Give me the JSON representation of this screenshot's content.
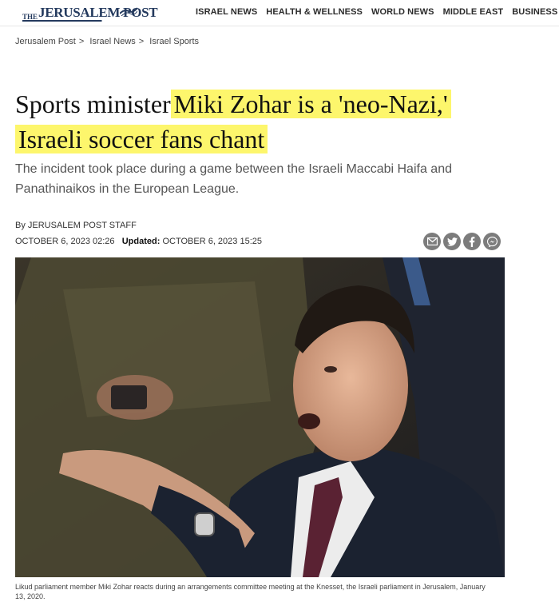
{
  "header": {
    "logo_the": "THE",
    "logo_name": "JERUSALEM POST",
    "nav": [
      {
        "label": "ISRAEL NEWS"
      },
      {
        "label": "HEALTH & WELLNESS"
      },
      {
        "label": "WORLD NEWS"
      },
      {
        "label": "MIDDLE EAST"
      },
      {
        "label": "BUSINESS & INNOVATION"
      }
    ]
  },
  "breadcrumb": [
    {
      "label": "Jerusalem Post"
    },
    {
      "label": "Israel News"
    },
    {
      "label": "Israel Sports"
    }
  ],
  "article": {
    "headline_plain": "Sports minister",
    "headline_highlight_1": "Miki Zohar is a 'neo-Nazi,'",
    "headline_highlight_2": "Israeli soccer fans chant",
    "subtitle": "The incident took place during a game between the Israeli Maccabi Haifa and Panathinaikos in the European League.",
    "byline": "By JERUSALEM POST STAFF",
    "date": "OCTOBER 6, 2023 02:26",
    "updated_label": "Updated:",
    "updated_date": "OCTOBER 6, 2023 15:25",
    "share_icons": [
      "mail-icon",
      "twitter-icon",
      "facebook-icon",
      "messenger-icon"
    ],
    "caption": "Likud parliament member Miki Zohar reacts during an arrangements committee meeting at the Knesset, the Israeli parliament in Jerusalem, January 13, 2020."
  },
  "colors": {
    "highlight": "#fdf66c",
    "brand": "#243a5e",
    "share_icon_bg": "#7c7c7c"
  }
}
